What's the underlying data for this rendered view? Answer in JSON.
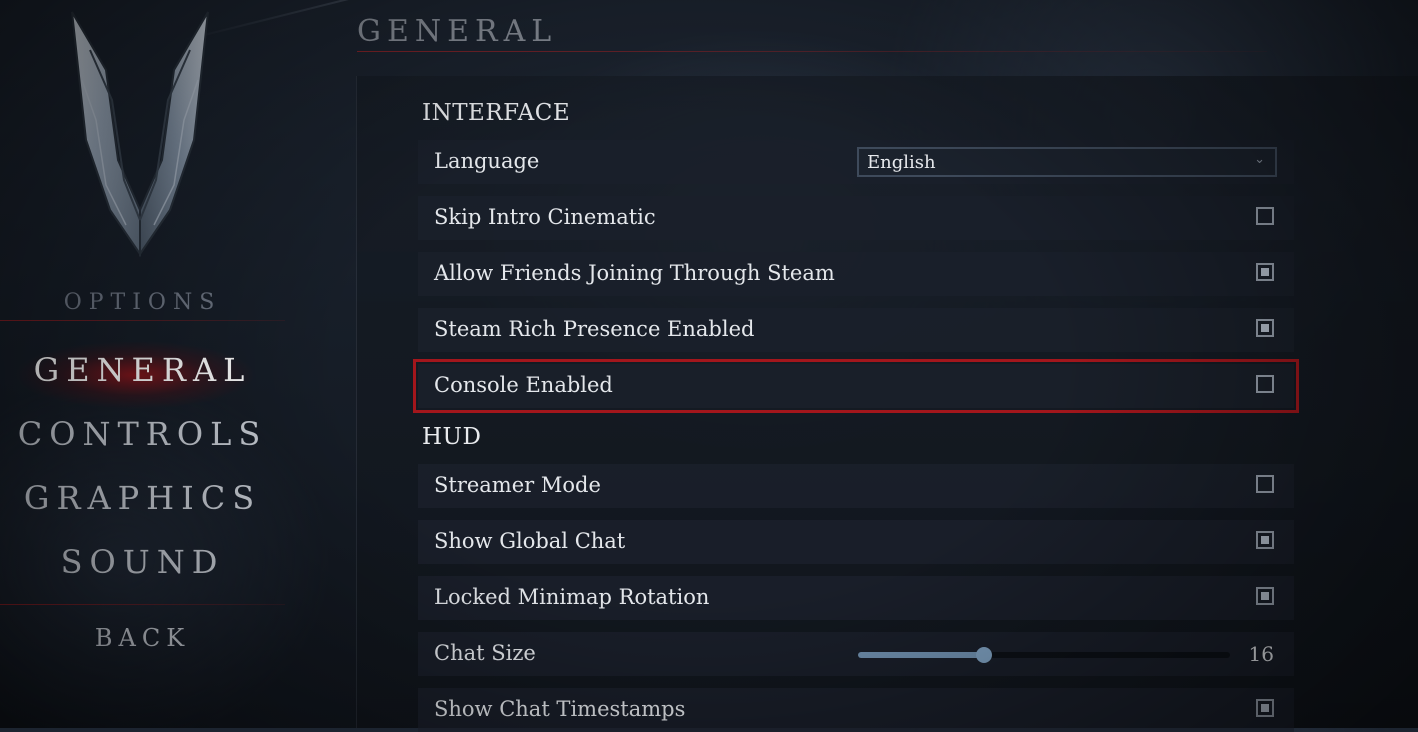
{
  "sidebar": {
    "options_label": "OPTIONS",
    "nav": [
      {
        "label": "GENERAL",
        "active": true
      },
      {
        "label": "CONTROLS",
        "active": false
      },
      {
        "label": "GRAPHICS",
        "active": false
      },
      {
        "label": "SOUND",
        "active": false
      }
    ],
    "back_label": "BACK"
  },
  "page": {
    "title": "GENERAL"
  },
  "sections": {
    "interface": {
      "title": "INTERFACE",
      "language": {
        "label": "Language",
        "value": "English"
      },
      "skip_intro": {
        "label": "Skip Intro Cinematic",
        "checked": false
      },
      "allow_friends": {
        "label": "Allow Friends Joining Through Steam",
        "checked": true
      },
      "steam_presence": {
        "label": "Steam Rich Presence Enabled",
        "checked": true
      },
      "console": {
        "label": "Console Enabled",
        "checked": false,
        "highlighted": true
      }
    },
    "hud": {
      "title": "HUD",
      "streamer_mode": {
        "label": "Streamer Mode",
        "checked": false
      },
      "global_chat": {
        "label": "Show Global Chat",
        "checked": true
      },
      "locked_minimap": {
        "label": "Locked Minimap Rotation",
        "checked": true
      },
      "chat_size": {
        "label": "Chat Size",
        "value": "16",
        "fraction": 0.34
      },
      "chat_timestamps": {
        "label": "Show Chat Timestamps",
        "checked": true
      }
    }
  },
  "colors": {
    "accent_red": "#a3161c",
    "slider_blue": "#6f8fae"
  }
}
